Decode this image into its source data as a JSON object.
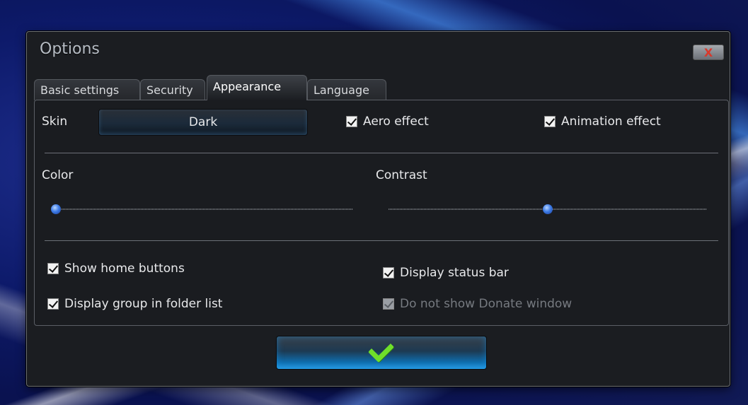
{
  "window": {
    "title": "Options",
    "close_glyph": "X"
  },
  "tabs": [
    {
      "label": "Basic settings",
      "active": false
    },
    {
      "label": "Security",
      "active": false
    },
    {
      "label": "Appearance",
      "active": true
    },
    {
      "label": "Language",
      "active": false
    }
  ],
  "appearance": {
    "skin_label": "Skin",
    "skin_value": "Dark",
    "aero_effect": {
      "label": "Aero effect",
      "checked": true
    },
    "animation_effect": {
      "label": "Animation effect",
      "checked": true
    },
    "color_label": "Color",
    "contrast_label": "Contrast",
    "color_slider_fraction": 0.0,
    "contrast_slider_fraction": 0.5,
    "show_home_buttons": {
      "label": "Show home buttons",
      "checked": true
    },
    "display_status_bar": {
      "label": "Display status bar",
      "checked": true
    },
    "display_group_in_folder_list": {
      "label": "Display group in folder list",
      "checked": true
    },
    "do_not_show_donate": {
      "label": "Do not show Donate window",
      "checked": true,
      "disabled": true
    }
  },
  "ok_button": {
    "icon": "checkmark-icon"
  },
  "colors": {
    "accent": "#2a9be0",
    "check": "#6fe02a",
    "slider": "#3d7be6"
  }
}
